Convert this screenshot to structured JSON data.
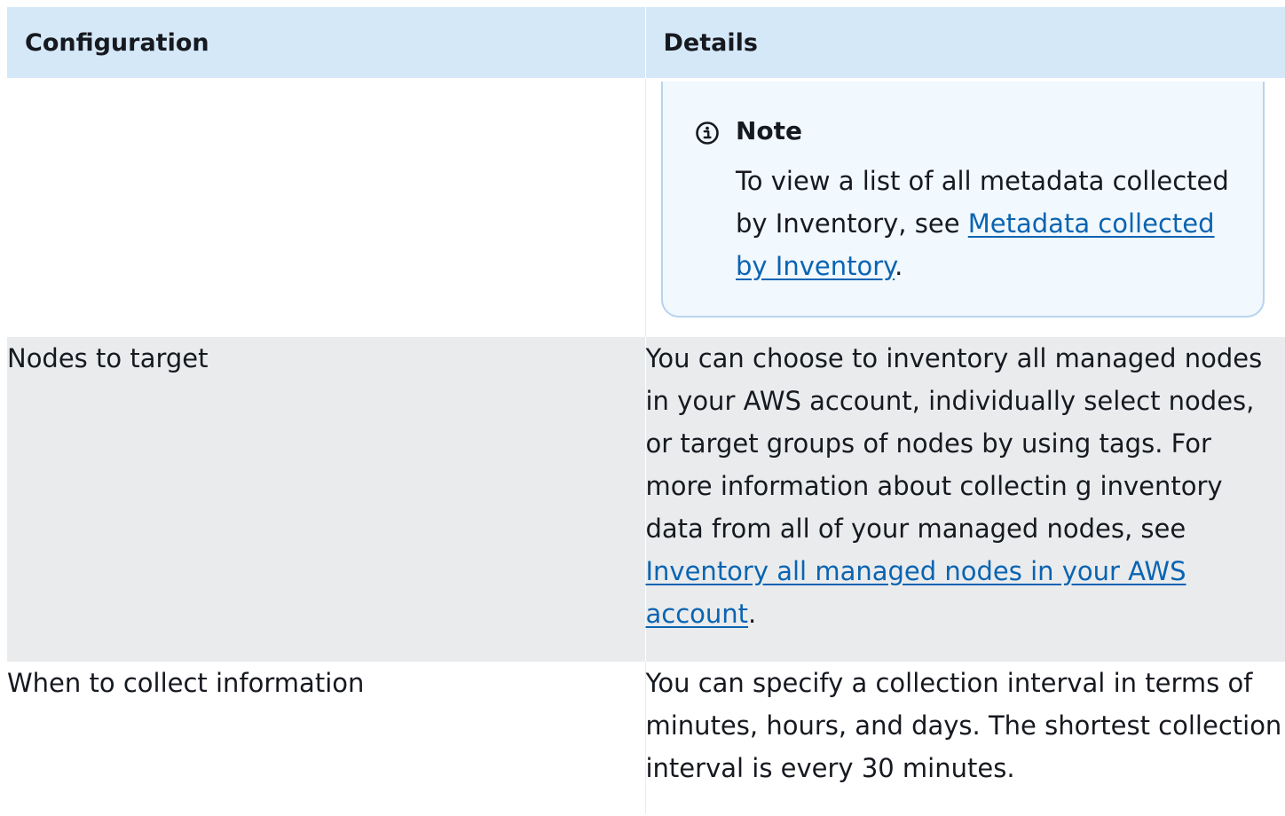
{
  "table": {
    "headers": {
      "configuration": "Configuration",
      "details": "Details"
    },
    "note": {
      "title": "Note",
      "text_before": "To view a list of all metadata collected by Inventory, see ",
      "link": "Metadata collected by Inventory",
      "text_after": "."
    },
    "rows": [
      {
        "configuration": "Nodes to target",
        "details_before": "You can choose to inventory all managed nodes in your AWS account, individually select nodes, or target groups of nodes by using tags. For more information about collectin g inventory data from all of your managed nodes, see ",
        "link": "Inventory all managed nodes in your AWS account",
        "details_after": "."
      },
      {
        "configuration": "When to collect information",
        "details": "You can specify a collection interval in terms of minutes, hours, and days. The shortest collection interval is every 30 minutes."
      }
    ]
  },
  "colors": {
    "header_bg": "#d5e8f8",
    "stripe_bg": "#e9ebed",
    "note_bg": "#f1f8fe",
    "note_border": "#b7d4ee",
    "link": "#0a64b1"
  },
  "icons": {
    "note": "info-circle-icon"
  }
}
